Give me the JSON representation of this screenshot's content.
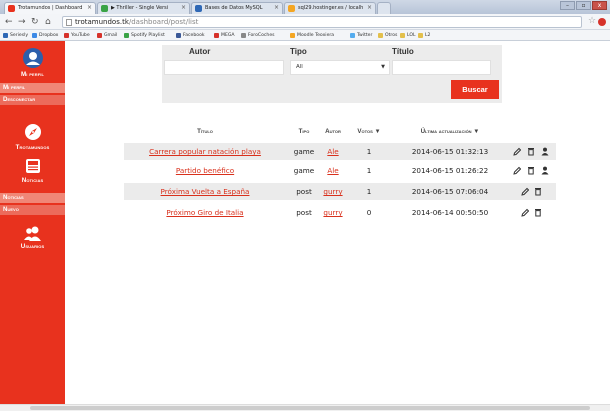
{
  "browser": {
    "tabs": [
      {
        "label": "Trotamundos | Dashboard",
        "icon_color": "#e8321e"
      },
      {
        "label": "▶ Thriller - Single Versi",
        "icon_color": "#3aa346"
      },
      {
        "label": "Bases de Datos MySQL",
        "icon_color": "#2f68b5"
      },
      {
        "label": "sql29.hostinger.es / localh",
        "icon_color": "#f4a623"
      }
    ],
    "url_host": "trotamundos.tk",
    "url_path": "/dashboard/post/list",
    "window_controls": [
      "–",
      "▫",
      "x"
    ],
    "bookmarks": [
      {
        "label": "Seriesly",
        "color": "#2f68b5"
      },
      {
        "label": "Dropbox",
        "color": "#3d8ae6"
      },
      {
        "label": "YouTube",
        "color": "#d6322b"
      },
      {
        "label": "Gmail",
        "color": "#d6322b"
      },
      {
        "label": "Spotify Playlist",
        "color": "#3aa346"
      },
      {
        "label": "Facebook",
        "color": "#3b5998"
      },
      {
        "label": "MEGA",
        "color": "#d6322b"
      },
      {
        "label": "ForoCoches",
        "color": "#888888"
      },
      {
        "label": "Moodle Teoxiera",
        "color": "#f4a623"
      },
      {
        "label": "Twitter",
        "color": "#55acee"
      },
      {
        "label": "Otros",
        "color": "#e3c04c"
      },
      {
        "label": "LOL",
        "color": "#e3c04c"
      },
      {
        "label": "L2",
        "color": "#e3c04c"
      }
    ]
  },
  "sidebar": {
    "accent": "#e8321e",
    "profile": {
      "label": "Mi perfil",
      "sub": [
        "Mi perfil",
        "Desconectar"
      ]
    },
    "trotamundos": {
      "label": "Trotamundos"
    },
    "noticias": {
      "label": "Noticias",
      "sub": [
        "Noticias",
        "Nuevo"
      ]
    },
    "usuarios": {
      "label": "Usuarios"
    }
  },
  "search": {
    "autor_label": "Autor",
    "tipo_label": "Tipo",
    "tipo_value": "All",
    "titulo_label": "Título",
    "button": "Buscar"
  },
  "table": {
    "headers": {
      "titulo": "Título",
      "tipo": "Tipo",
      "autor": "Autor",
      "votos": "Votos ▼",
      "fecha": "Última actualización ▼"
    },
    "rows": [
      {
        "titulo": "Carrera popular natación playa",
        "tipo": "game",
        "autor": "Ale",
        "votos": "1",
        "fecha": "2014-06-15 01:32:13"
      },
      {
        "titulo": "Partido benéfico",
        "tipo": "game",
        "autor": "Ale",
        "votos": "1",
        "fecha": "2014-06-15 01:26:22"
      },
      {
        "titulo": "Próxima Vuelta a España",
        "tipo": "post",
        "autor": "gurry",
        "votos": "1",
        "fecha": "2014-06-15 07:06:04"
      },
      {
        "titulo": "Próximo Giro de Italia",
        "tipo": "post",
        "autor": "gurry",
        "votos": "0",
        "fecha": "2014-06-14 00:50:50"
      }
    ]
  }
}
